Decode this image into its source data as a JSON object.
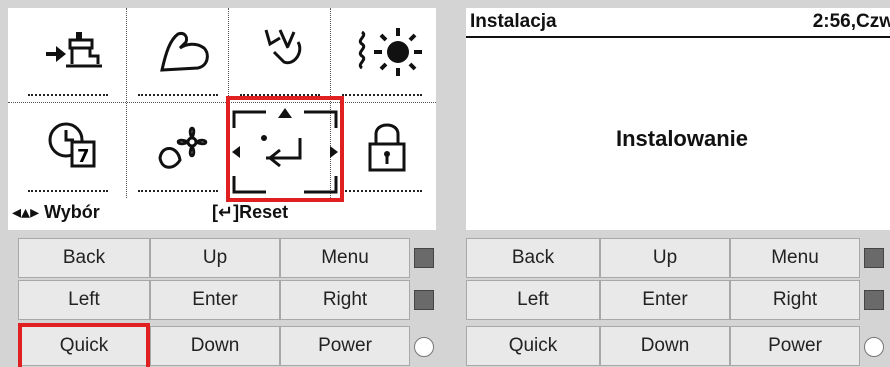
{
  "left_display": {
    "icons": [
      {
        "name": "water-tap-icon"
      },
      {
        "name": "arm-strength-icon"
      },
      {
        "name": "hand-sensor-icon"
      },
      {
        "name": "sun-heat-icon"
      },
      {
        "name": "clock-calendar-icon"
      },
      {
        "name": "fan-flower-icon"
      },
      {
        "name": "install-return-icon"
      },
      {
        "name": "padlock-icon"
      }
    ],
    "hint_left": "◂▴▸ Wybór",
    "hint_right": "[↵]Reset"
  },
  "right_display": {
    "status_title": "Instalacja",
    "status_time": "2:56,Czw",
    "message": "Instalowanie"
  },
  "buttons": {
    "back": "Back",
    "up": "Up",
    "menu": "Menu",
    "left": "Left",
    "enter": "Enter",
    "right": "Right",
    "quick": "Quick",
    "down": "Down",
    "power": "Power"
  },
  "colors": {
    "highlight": "#e02020",
    "panel_bg": "#d4d4d4",
    "button_bg": "#e9e9e9",
    "led": "#6a6a6a"
  }
}
